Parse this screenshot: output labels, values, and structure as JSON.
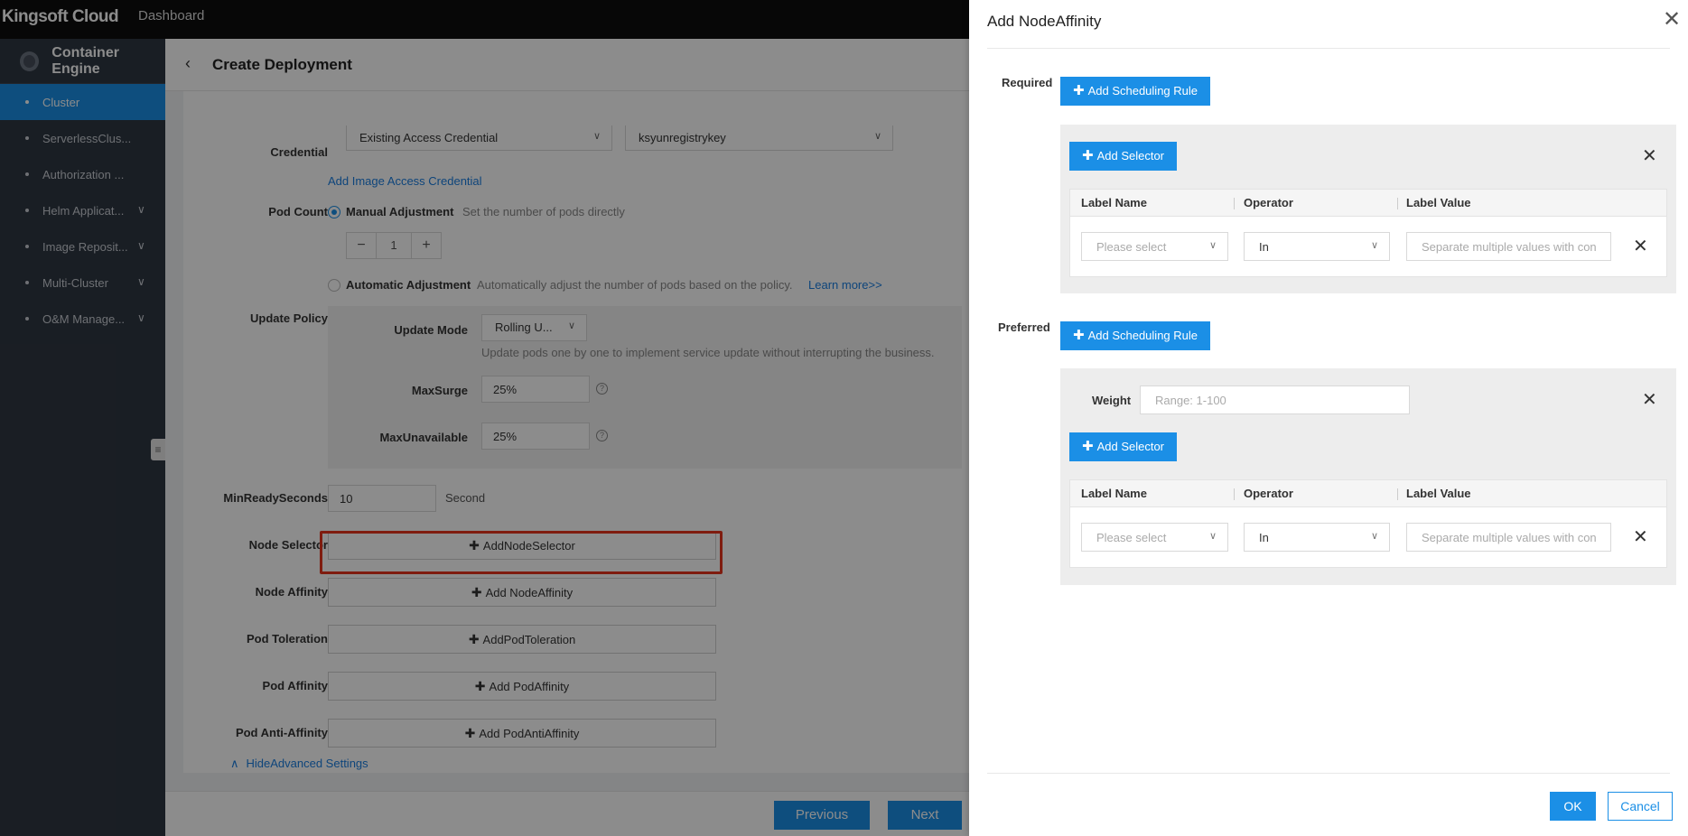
{
  "topbar": {
    "brand": "Kingsoft Cloud",
    "nav": "Dashboard"
  },
  "sidebar": {
    "title": "Container Engine",
    "items": [
      {
        "label": "Cluster",
        "active": true
      },
      {
        "label": "ServerlessClus..."
      },
      {
        "label": "Authorization ..."
      },
      {
        "label": "Helm Applicat...",
        "expandable": true
      },
      {
        "label": "Image Reposit...",
        "expandable": true
      },
      {
        "label": "Multi-Cluster",
        "expandable": true
      },
      {
        "label": "O&M Manage...",
        "expandable": true
      }
    ]
  },
  "page": {
    "title": "Create Deployment"
  },
  "form": {
    "credential_label": "Credential",
    "credential_type": "Existing Access Credential",
    "credential_value": "ksyunregistrykey",
    "add_credential_link": "Add Image Access Credential",
    "pod_count_label": "Pod Count",
    "manual_label": "Manual Adjustment",
    "manual_desc": "Set the number of pods directly",
    "pod_count_value": "1",
    "auto_label": "Automatic Adjustment",
    "auto_desc": "Automatically adjust the number of pods based on the policy.",
    "learn_more": "Learn more>>",
    "update_policy_label": "Update Policy",
    "update_mode_label": "Update Mode",
    "update_mode_value": "Rolling U...",
    "update_mode_desc": "Update pods one by one to implement service update without interrupting the business.",
    "max_surge_label": "MaxSurge",
    "max_surge_value": "25%",
    "max_unavailable_label": "MaxUnavailable",
    "max_unavailable_value": "25%",
    "min_ready_label": "MinReadySeconds",
    "min_ready_value": "10",
    "min_ready_unit": "Second",
    "node_selector_label": "Node Selector",
    "node_selector_btn": "AddNodeSelector",
    "node_affinity_label": "Node Affinity",
    "node_affinity_btn": "Add NodeAffinity",
    "pod_toleration_label": "Pod Toleration",
    "pod_toleration_btn": "AddPodToleration",
    "pod_affinity_label": "Pod Affinity",
    "pod_affinity_btn": "Add PodAffinity",
    "pod_anti_affinity_label": "Pod Anti-Affinity",
    "pod_anti_affinity_btn": "Add PodAntiAffinity",
    "hide_advanced": "HideAdvanced Settings"
  },
  "footer": {
    "previous": "Previous",
    "next": "Next"
  },
  "drawer": {
    "title": "Add NodeAffinity",
    "required_label": "Required",
    "preferred_label": "Preferred",
    "add_rule_btn": "Add Scheduling Rule",
    "add_selector_btn": "Add Selector",
    "weight_label": "Weight",
    "weight_placeholder": "Range: 1-100",
    "columns": [
      "Label Name",
      "Operator",
      "Label Value"
    ],
    "label_name_placeholder": "Please select",
    "operator_value": "In",
    "label_value_placeholder": "Separate multiple values with con",
    "ok": "OK",
    "cancel": "Cancel"
  },
  "colors": {
    "accent": "#1b8fe6",
    "highlight": "#e8341c",
    "sidebar_bg": "#2f3742"
  }
}
